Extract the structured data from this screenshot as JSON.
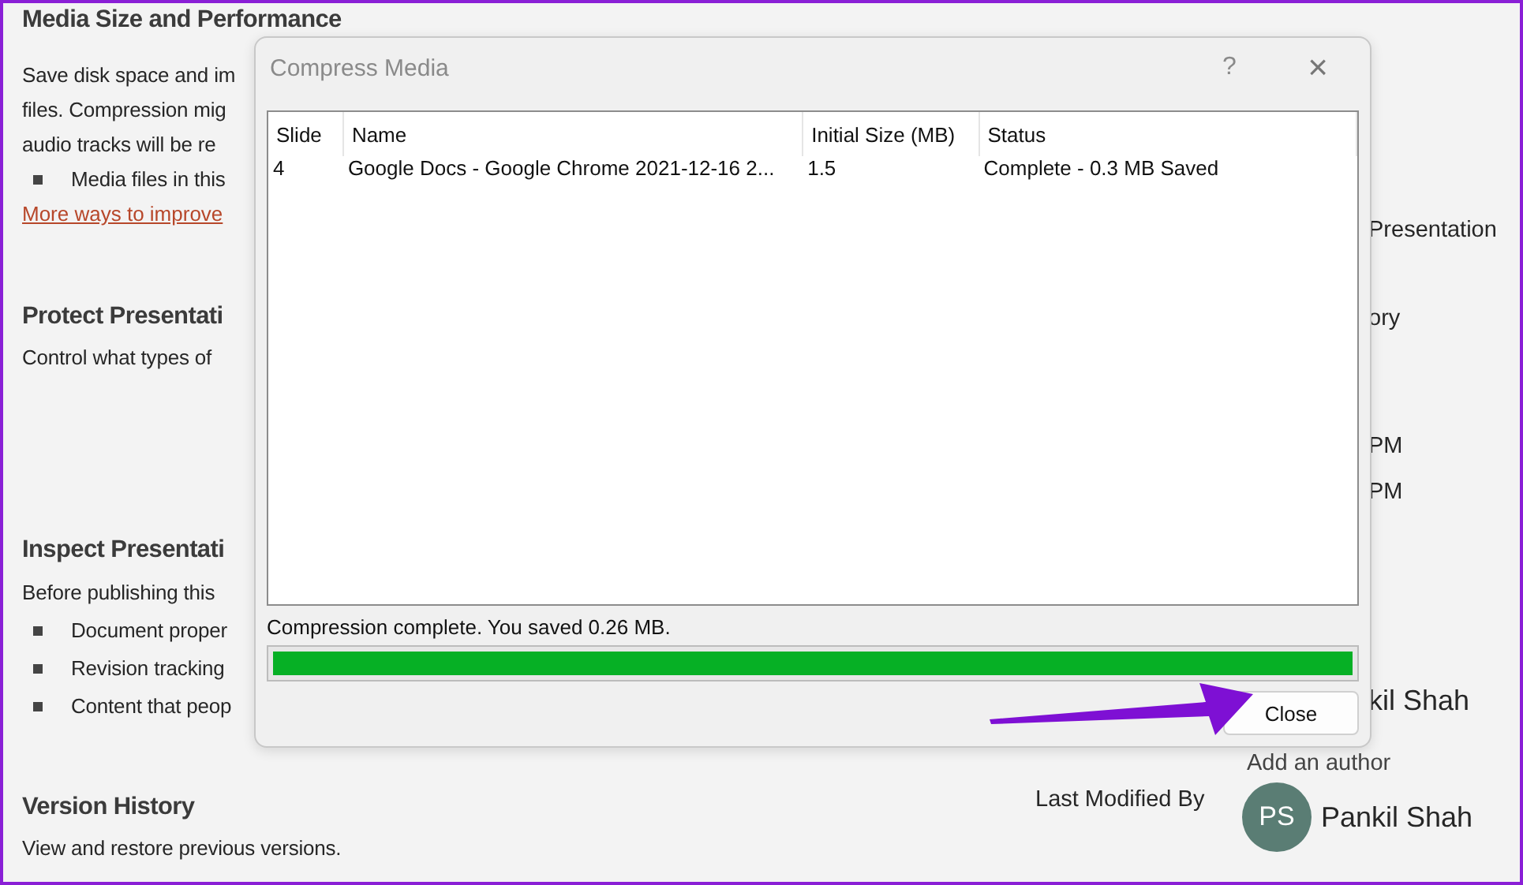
{
  "info_pane": {
    "sections": [
      {
        "heading": "Media Size and Performance",
        "lines": [
          "Save disk space and im",
          "files. Compression mig",
          "audio tracks will be re"
        ],
        "bullets": [
          "Media files in this"
        ],
        "link": "More ways to improve"
      },
      {
        "heading": "Protect Presentati",
        "lines": [
          "Control what types of"
        ]
      },
      {
        "heading": "Inspect Presentati",
        "lines": [
          "Before publishing this"
        ],
        "bullets": [
          "Document proper",
          "Revision tracking",
          "Content that peop"
        ]
      },
      {
        "heading": "Version History",
        "lines": [
          "View and restore previous versions."
        ]
      }
    ],
    "properties": [
      "Presentation",
      "ory",
      "PM",
      "PM"
    ],
    "author": "kil Shah",
    "add_author": "Add an author",
    "last_modified": {
      "label": "Last Modified By",
      "initials": "PS",
      "name": "Pankil Shah"
    }
  },
  "dialog": {
    "title": "Compress Media",
    "help": "?",
    "close_glyph": "×",
    "table": {
      "columns": [
        "Slide",
        "Name",
        "Initial Size (MB)",
        "Status"
      ],
      "rows": [
        [
          "4",
          "Google Docs - Google Chrome 2021-12-16 2...",
          "1.5",
          "Complete - 0.3 MB Saved"
        ]
      ]
    },
    "status": "Compression complete. You saved 0.26 MB.",
    "progress": {
      "level": 1
    },
    "button": "Close"
  }
}
